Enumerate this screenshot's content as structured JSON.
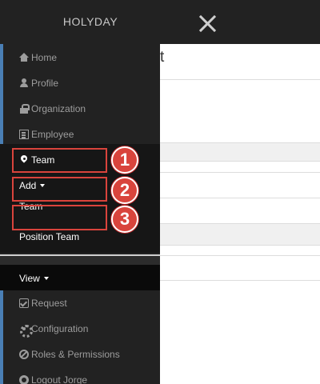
{
  "header": {
    "brand": "HOLYDAY",
    "close_icon": "close-icon"
  },
  "background": {
    "title_fragment": "t"
  },
  "sidebar": {
    "items": [
      {
        "label": "Home",
        "icon": "home-icon"
      },
      {
        "label": "Profile",
        "icon": "user-icon"
      },
      {
        "label": "Organization",
        "icon": "lock-icon"
      },
      {
        "label": "Employee",
        "icon": "list-icon"
      },
      {
        "label": "Team",
        "icon": "map-marker-icon"
      }
    ],
    "add_dropdown": {
      "label": "Add",
      "icon": "caret-down-icon"
    },
    "add_options": [
      "Team",
      "Position Team"
    ],
    "view_dropdown": {
      "label": "View",
      "icon": "caret-down-icon"
    },
    "bottom_items": [
      {
        "label": "Request",
        "icon": "edit-icon"
      },
      {
        "label": "Configuration",
        "icon": "gear-icon"
      },
      {
        "label": "Roles & Permissions",
        "icon": "ban-icon"
      },
      {
        "label": "Logout Jorge",
        "icon": "logout-icon"
      }
    ]
  },
  "annotations": [
    "1",
    "2",
    "3"
  ],
  "colors": {
    "topbar": "#222222",
    "drawer": "#222222",
    "accent": "#4a7fb5",
    "highlight": "#d9443c"
  }
}
